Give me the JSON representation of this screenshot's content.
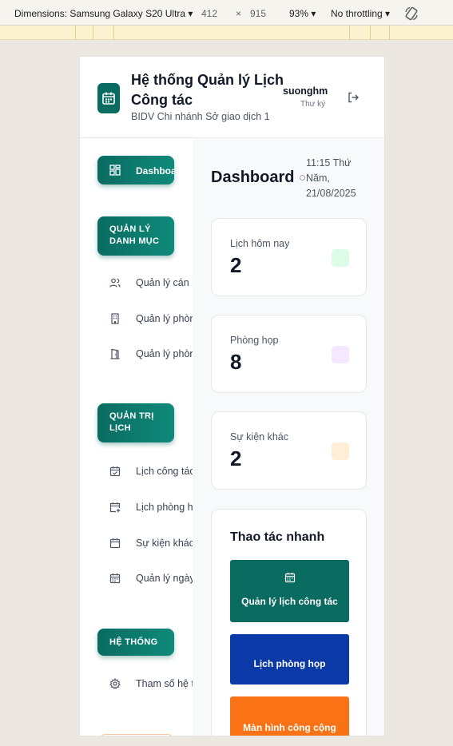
{
  "devtools": {
    "device": "Dimensions: Samsung Galaxy S20 Ultra",
    "width": "412",
    "times": "×",
    "height": "915",
    "zoom": "93%",
    "throttling": "No throttling"
  },
  "header": {
    "title": "Hệ thống Quản lý Lịch Công tác",
    "subtitle": "BIDV Chi nhánh Sở giao dịch 1",
    "user_name": "suonghm",
    "user_role": "Thư ký"
  },
  "sidebar": {
    "dashboard_label": "Dashboard",
    "sections": [
      {
        "title": "QUẢN LÝ DANH MỤC",
        "items": [
          {
            "label": "Quản lý cán bộ",
            "icon": "users-icon"
          },
          {
            "label": "Quản lý phòng ban",
            "icon": "building-icon"
          },
          {
            "label": "Quản lý phòng họp",
            "icon": "door-icon"
          }
        ]
      },
      {
        "title": "QUẢN TRỊ LỊCH",
        "items": [
          {
            "label": "Lịch công tác",
            "icon": "calendar-check-icon"
          },
          {
            "label": "Lịch phòng họp",
            "icon": "calendar-plus-icon"
          },
          {
            "label": "Sự kiện khác",
            "icon": "calendar-icon"
          },
          {
            "label": "Quản lý ngày lễ",
            "icon": "calendar-grid-icon"
          }
        ]
      },
      {
        "title": "HỆ THỐNG",
        "items": [
          {
            "label": "Tham số hệ thống",
            "icon": "gear-icon"
          }
        ]
      }
    ]
  },
  "main": {
    "page_title": "Dashboard",
    "datetime": "11:15 Thứ Năm, 21/08/2025",
    "stats": [
      {
        "label": "Lịch hôm nay",
        "value": "2",
        "color": "#dcfce7"
      },
      {
        "label": "Phòng họp",
        "value": "8",
        "color": "#f3e8ff"
      },
      {
        "label": "Sự kiện khác",
        "value": "2",
        "color": "#ffedd5"
      }
    ],
    "quick_actions": {
      "title": "Thao tác nhanh",
      "buttons": [
        {
          "label": "Quản lý lịch công tác",
          "color": "#0a6b61"
        },
        {
          "label": "Lịch phòng họp",
          "color": "#0b3aa8"
        },
        {
          "label": "Màn hình công cộng",
          "color": "#f97316"
        }
      ]
    }
  }
}
